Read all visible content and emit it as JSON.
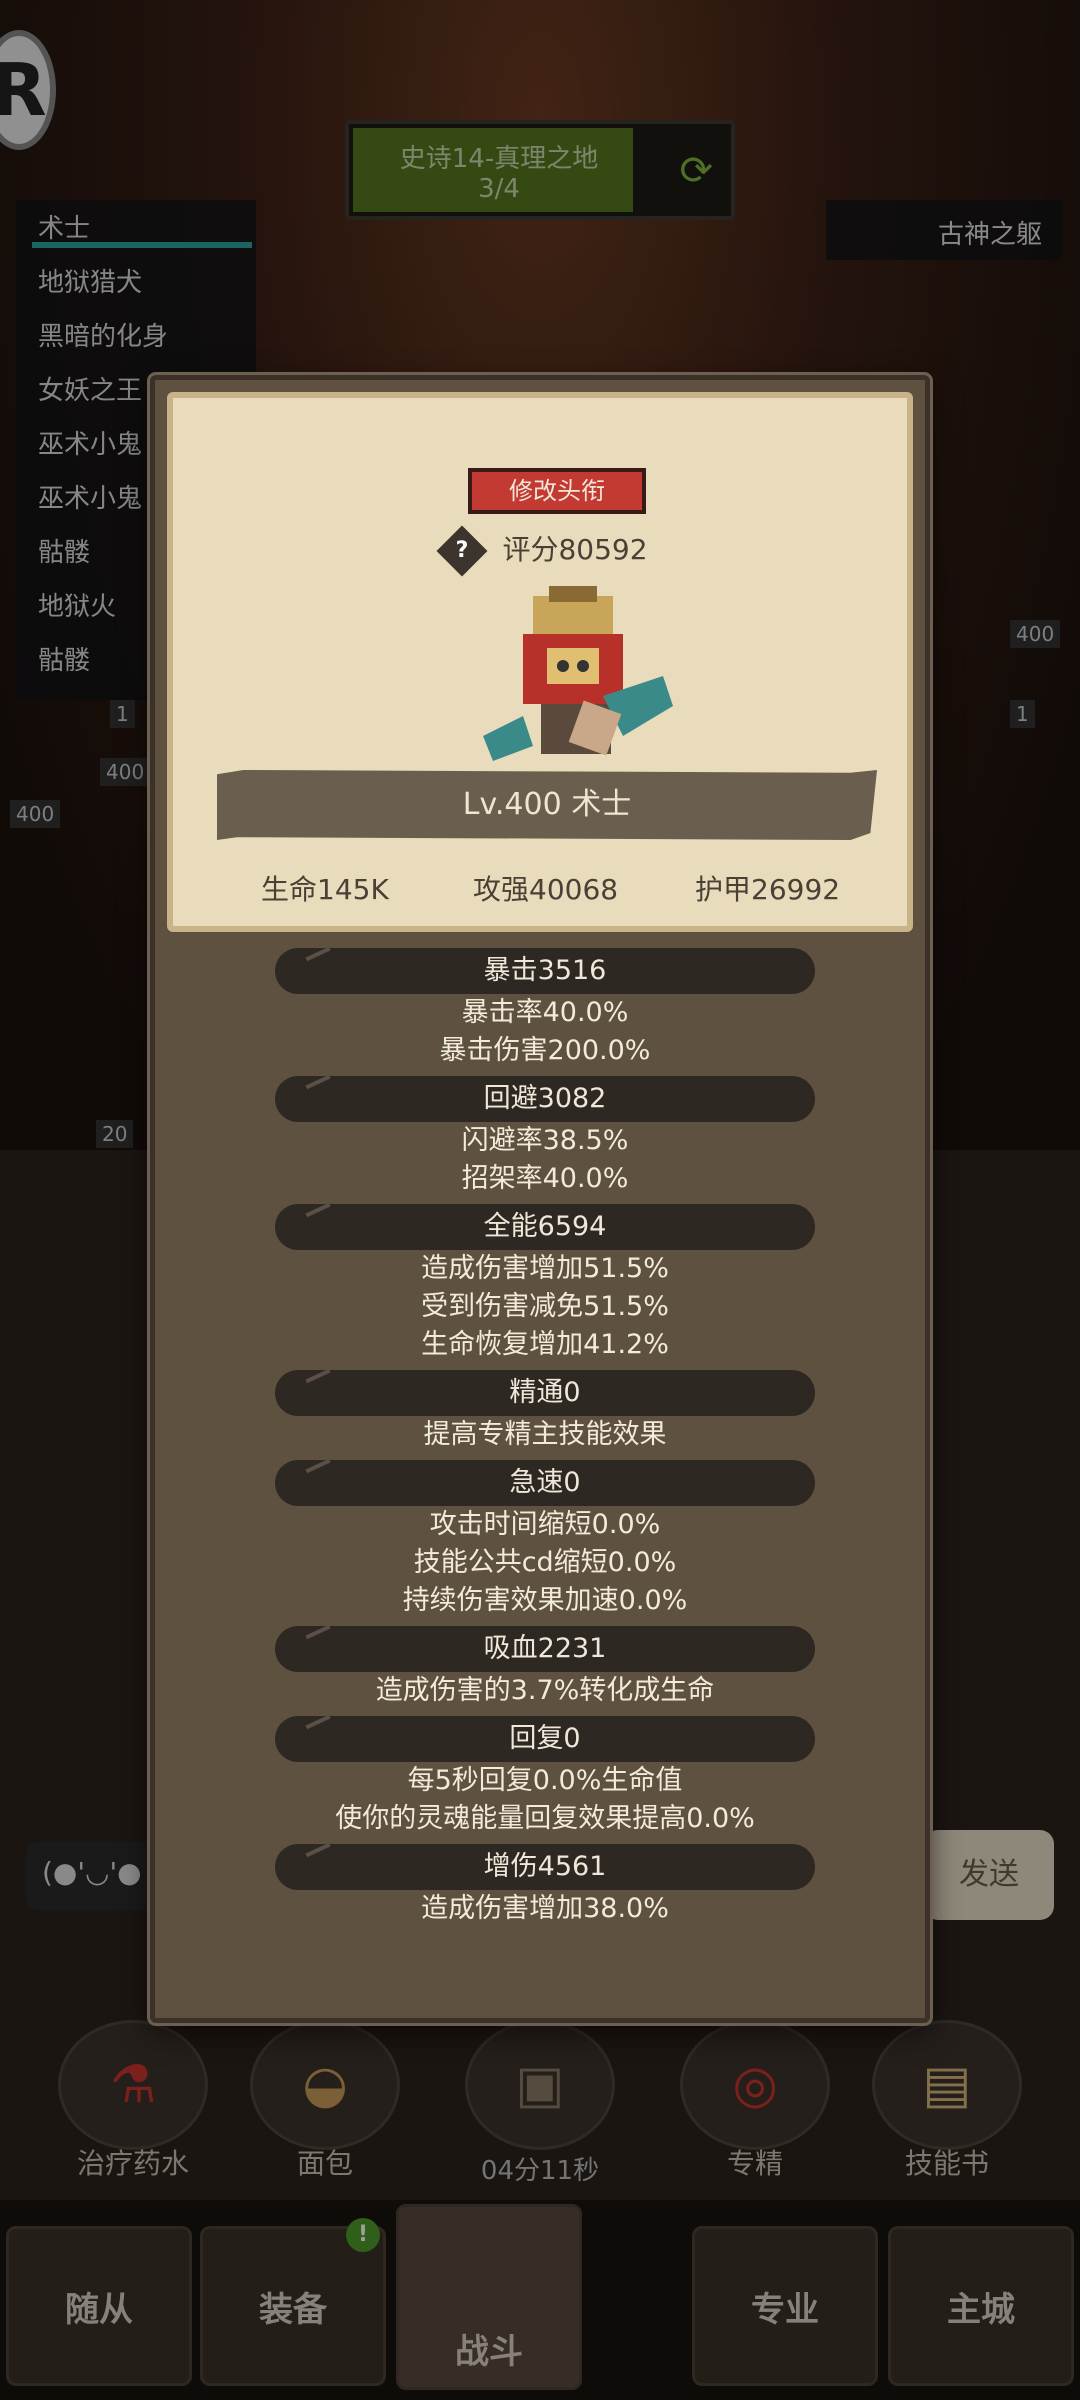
{
  "background": {
    "logo_letter": "R",
    "stage": {
      "title": "史诗14-真理之地",
      "progress": "3/4",
      "refresh_icon": "refresh-icon"
    },
    "enemies": [
      "术士",
      "地狱猎犬",
      "黑暗的化身",
      "女妖之王",
      "巫术小鬼",
      "巫术小鬼",
      "骷髅",
      "地狱火",
      "骷髅"
    ],
    "boss_label": "古神之躯",
    "side_badges": [
      "400",
      "1",
      "400",
      "1",
      "400",
      "20"
    ],
    "chat": {
      "input_text": "(●'◡'●",
      "send_label": "发送"
    },
    "quick_items": [
      {
        "label": "治疗药水",
        "icon": "potion-icon"
      },
      {
        "label": "面包",
        "icon": "bread-icon"
      },
      {
        "label": "",
        "icon": "chest-icon"
      },
      {
        "label": "专精",
        "icon": "specialization-icon"
      },
      {
        "label": "技能书",
        "icon": "skillbook-icon"
      }
    ],
    "timer": "04分11秒",
    "nav": [
      "随从",
      "装备",
      "战斗",
      "专业",
      "主城"
    ],
    "nav_active": "战斗",
    "nav_badge": "!"
  },
  "popup": {
    "rename_label": "修改头衔",
    "help_icon": "?",
    "score": "评分80592",
    "level_name": "Lv.400 术士",
    "base_stats": {
      "hp": "生命145K",
      "attack": "攻强40068",
      "armor": "护甲26992"
    },
    "stat_groups": [
      {
        "header": "暴击3516",
        "lines": [
          "暴击率40.0%",
          "暴击伤害200.0%"
        ]
      },
      {
        "header": "回避3082",
        "lines": [
          "闪避率38.5%",
          "招架率40.0%"
        ]
      },
      {
        "header": "全能6594",
        "lines": [
          "造成伤害增加51.5%",
          "受到伤害减免51.5%",
          "生命恢复增加41.2%"
        ]
      },
      {
        "header": "精通0",
        "lines": [
          "提高专精主技能效果"
        ]
      },
      {
        "header": "急速0",
        "lines": [
          "攻击时间缩短0.0%",
          "技能公共cd缩短0.0%",
          "持续伤害效果加速0.0%"
        ]
      },
      {
        "header": "吸血2231",
        "lines": [
          "造成伤害的3.7%转化成生命"
        ]
      },
      {
        "header": "回复0",
        "lines": [
          "每5秒回复0.0%生命值",
          "使你的灵魂能量回复效果提高0.0%"
        ]
      },
      {
        "header": "增伤4561",
        "lines": [
          "造成伤害增加38.0%"
        ]
      }
    ]
  }
}
